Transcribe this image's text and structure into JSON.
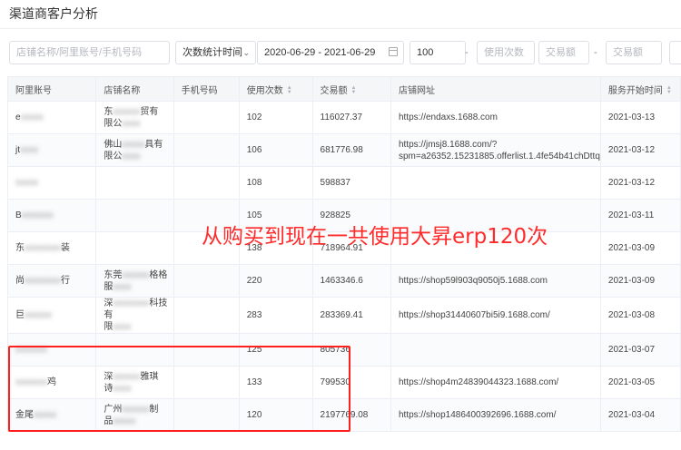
{
  "page_title": "渠道商客户分析",
  "filters": {
    "search_placeholder": "店铺名称/阿里账号/手机号码",
    "stat_type_label": "次数统计时间",
    "date_range": "2020-06-29 - 2021-06-29",
    "usage_count_min": "100",
    "usage_count_max_placeholder": "使用次数",
    "trade_min_placeholder": "交易额",
    "trade_max_placeholder": "交易额",
    "separator": "-"
  },
  "table": {
    "headers": [
      "阿里账号",
      "店铺名称",
      "手机号码",
      "使用次数",
      "交易额",
      "店铺网址",
      "服务开始时间"
    ],
    "rows": [
      {
        "account": "e",
        "account_masked": "xxxxx",
        "shop": "东",
        "shop_masked": "xxxxxx",
        "shop_tail": "贸有",
        "shop_line2": "限公",
        "shop_line2_masked": "xxxx",
        "phone": "",
        "uses": "102",
        "amount": "116027.37",
        "url": "https://endaxs.1688.com",
        "start": "2021-03-13"
      },
      {
        "account": "jt",
        "account_masked": "xxxx",
        "shop": "佛山",
        "shop_masked": "xxxxx",
        "shop_tail": "具有",
        "shop_line2": "限公",
        "shop_line2_masked": "xxxx",
        "phone": "",
        "uses": "106",
        "amount": "681776.98",
        "url": "https://jmsj8.1688.com/?spm=a26352.15231885.offerlist.1.4fe54b41chDttq",
        "start": "2021-03-12"
      },
      {
        "account": "",
        "account_masked": "xxxxx",
        "shop": "",
        "shop_masked": "",
        "shop_tail": "",
        "shop_line2": "",
        "shop_line2_masked": "",
        "phone": "",
        "uses": "108",
        "amount": "598837",
        "url": "",
        "start": "2021-03-12"
      },
      {
        "account": "B",
        "account_masked": "xxxxxxx",
        "shop": "",
        "shop_masked": "",
        "shop_tail": "",
        "shop_line2": "",
        "shop_line2_masked": "",
        "phone": "",
        "uses": "105",
        "amount": "928825",
        "url": "",
        "start": "2021-03-11"
      },
      {
        "account": "东",
        "account_masked": "xxxxxxxx",
        "shop": "",
        "shop_masked": "",
        "shop_tail": "",
        "shop_line2": "",
        "shop_line2_masked": "",
        "phone": "",
        "uses": "138",
        "amount": "718964.91",
        "url": "",
        "start": "2021-03-09",
        "account_tail": "装"
      },
      {
        "account": "尚",
        "account_masked": "xxxxxxxx",
        "shop": "东莞",
        "shop_masked": "xxxxxx",
        "shop_tail": "格格",
        "shop_line2": "服",
        "shop_line2_masked": "xxxx",
        "phone": "",
        "uses": "220",
        "amount": "1463346.6",
        "url": "https://shop59l903q9050j5.1688.com",
        "start": "2021-03-09",
        "account_tail": "行"
      },
      {
        "account": "巨",
        "account_masked": "xxxxxx",
        "shop": "深",
        "shop_masked": "xxxxxxxx",
        "shop_tail": "科技有",
        "shop_line2": "限",
        "shop_line2_masked": "xxxx",
        "phone": "",
        "uses": "283",
        "amount": "283369.41",
        "url": "https://shop31440607bi5i9.1688.com/",
        "start": "2021-03-08"
      },
      {
        "account": "",
        "account_masked": "xxxxxxx",
        "shop": "",
        "shop_masked": "",
        "shop_tail": "",
        "shop_line2": "",
        "shop_line2_masked": "",
        "phone": "",
        "uses": "125",
        "amount": "805736",
        "url": "",
        "start": "2021-03-07"
      },
      {
        "account": "",
        "account_masked": "xxxxxxx",
        "shop": "深",
        "shop_masked": "xxxxxx",
        "shop_tail": "雅琪",
        "shop_line2": "诗",
        "shop_line2_masked": "xxxx",
        "phone": "",
        "uses": "133",
        "amount": "799530",
        "url": "https://shop4m24839044323.1688.com/",
        "start": "2021-03-05",
        "account_tail": "鸡"
      },
      {
        "account": "金尾",
        "account_masked": "xxxxx",
        "shop": "广州",
        "shop_masked": "xxxxxx",
        "shop_tail": "制",
        "shop_line2": "品",
        "shop_line2_masked": "xxxxx",
        "phone": "",
        "uses": "120",
        "amount": "2197769.08",
        "url": "https://shop1486400392696.1688.com/",
        "start": "2021-03-04"
      }
    ]
  },
  "annotation_text": "从购买到现在一共使用大昇erp120次",
  "colors": {
    "annotation": "#ff2a2a",
    "highlight_border": "#ff1f1f",
    "header_bg": "#f5f6f8"
  }
}
